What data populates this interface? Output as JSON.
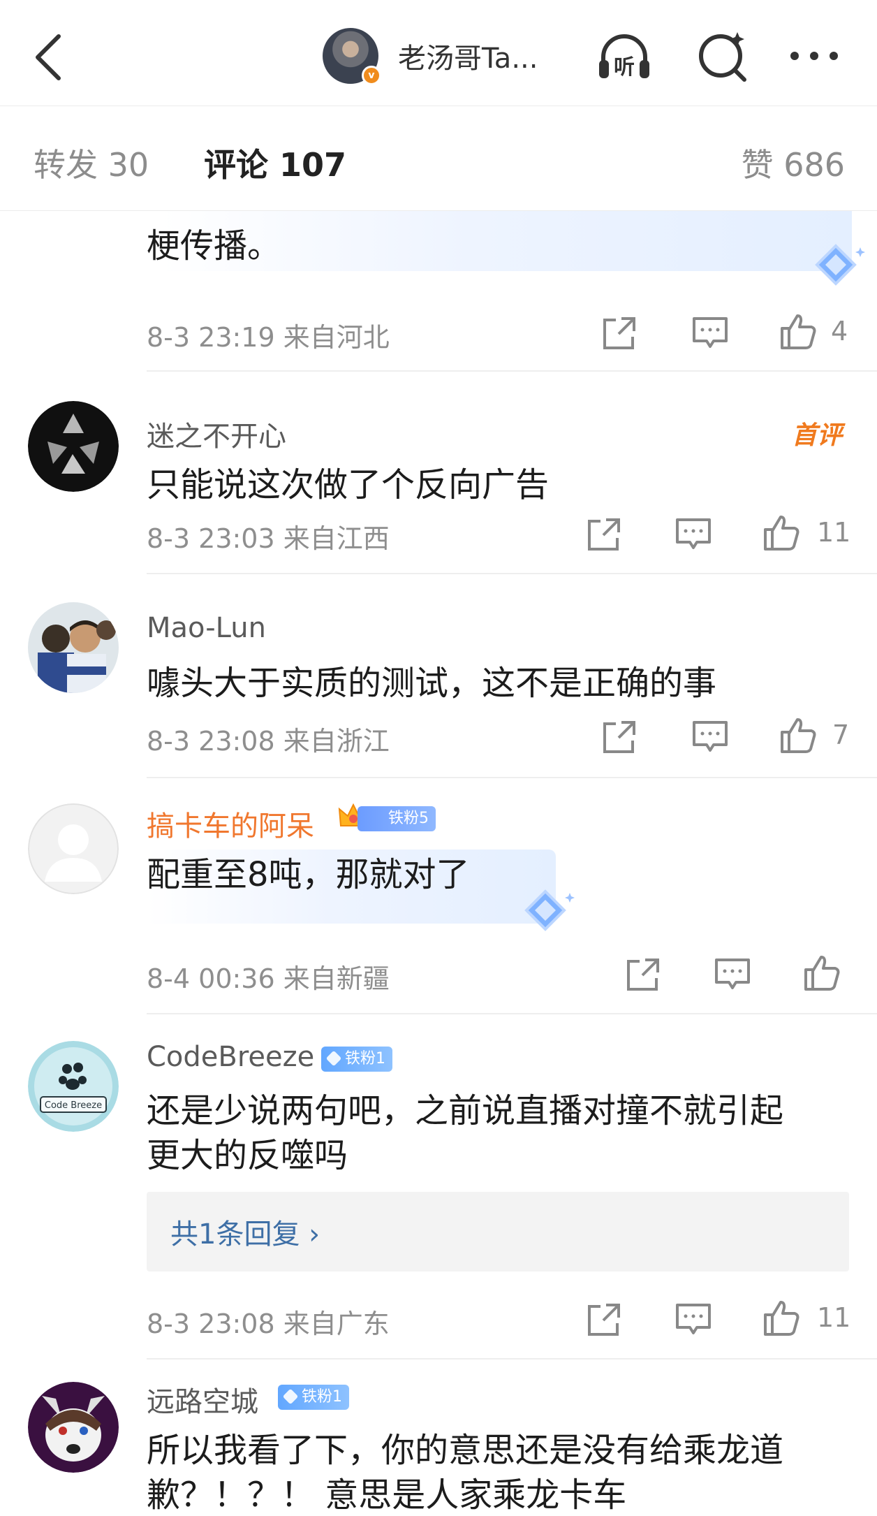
{
  "header": {
    "author_name": "老汤哥Ta...",
    "verified_mark": "v",
    "icons": [
      "back-icon",
      "listen-icon",
      "search-icon",
      "more-icon"
    ],
    "listen_label": "听"
  },
  "tabs": {
    "repost": "转发 30",
    "comments": "评论 107",
    "likes": "赞 686"
  },
  "comments": [
    {
      "text": "梗传播。",
      "time": "8-3 23:19",
      "location": "来自河北",
      "like_count": "4"
    },
    {
      "user": "迷之不开心",
      "first_badge": "首评",
      "text": "只能说这次做了个反向广告",
      "time": "8-3 23:03",
      "location": "来自江西",
      "like_count": "11"
    },
    {
      "user": "Mao-Lun",
      "text": "噱头大于实质的测试，这不是正确的事",
      "time": "8-3 23:08",
      "location": "来自浙江",
      "like_count": "7"
    },
    {
      "user": "搞卡车的阿呆",
      "fan_badge": "铁粉5",
      "text": "配重至8吨，那就对了",
      "time": "8-4 00:36",
      "location": "来自新疆",
      "like_count": ""
    },
    {
      "user": "CodeBreeze",
      "fan_badge": "铁粉1",
      "avatar_text": "Code Breeze",
      "text_line1": "还是少说两句吧，之前说直播对撞不就引起",
      "text_line2": "更大的反噬吗",
      "reply_summary": "共1条回复 ›",
      "time": "8-3 23:08",
      "location": "来自广东",
      "like_count": "11"
    },
    {
      "user": "远路空城",
      "fan_badge": "铁粉1",
      "text_line1": "所以我看了下，你的意思还是没有给乘龙道",
      "text_line2": "歉？！？！  意思是人家乘龙卡车"
    }
  ],
  "colors": {
    "accent_orange": "#f0772e",
    "link_blue": "#3e6fa6",
    "badge_blue": "#62a7ff",
    "meta_gray": "#8e8e8e"
  }
}
